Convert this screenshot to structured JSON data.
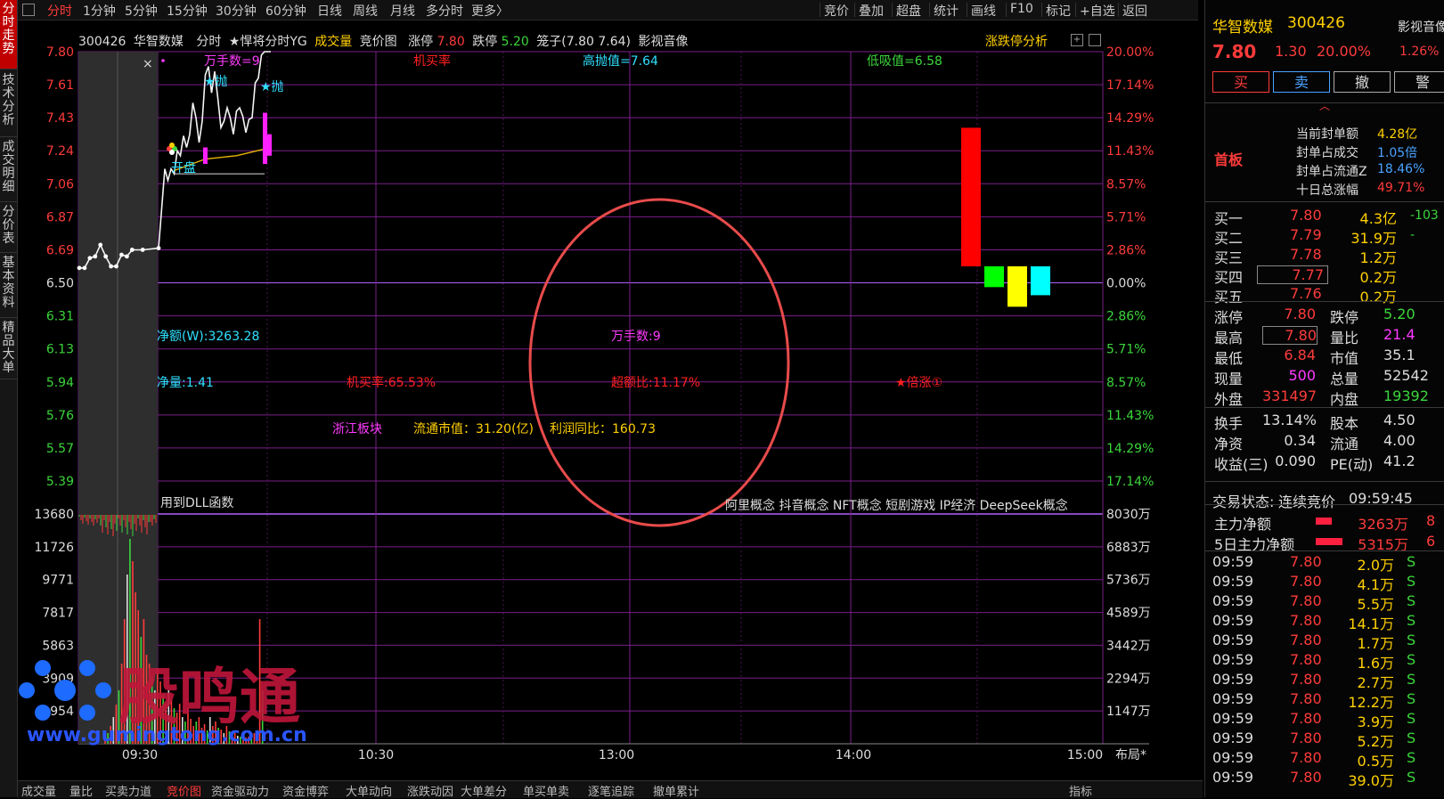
{
  "left_tabs": [
    {
      "label": "分时走势",
      "active": true
    },
    {
      "label": "技术分析",
      "active": false
    },
    {
      "label": "成交明细",
      "active": false
    },
    {
      "label": "分价表",
      "active": false
    },
    {
      "label": "基本资料",
      "active": false
    },
    {
      "label": "精品大单",
      "active": false
    }
  ],
  "periods": [
    {
      "label": "分时",
      "active": true
    },
    {
      "label": "1分钟"
    },
    {
      "label": "5分钟"
    },
    {
      "label": "15分钟"
    },
    {
      "label": "30分钟"
    },
    {
      "label": "60分钟"
    },
    {
      "label": "日线"
    },
    {
      "label": "周线"
    },
    {
      "label": "月线"
    },
    {
      "label": "多分时"
    },
    {
      "label": "更多〉"
    }
  ],
  "tools": [
    "竞价",
    "叠加",
    "超盘",
    "统计",
    "画线",
    "F10",
    "标记",
    "+自选",
    "返回"
  ],
  "info": {
    "code": "300426",
    "name": "华智数媒",
    "mode": "分时",
    "indicator": "★悍将分时YG",
    "volume": "成交量",
    "bid": "竞价图",
    "limit_up_label": "涨停",
    "limit_up": "7.80",
    "limit_down_label": "跌停",
    "limit_down": "5.20",
    "ladder": "笼子(7.80 7.64)",
    "concept": "影视音像",
    "analysis": "涨跌停分析"
  },
  "chart_data": {
    "type": "line",
    "price_ticks": [
      "7.80",
      "7.61",
      "7.43",
      "7.24",
      "7.06",
      "6.87",
      "6.69",
      "6.50",
      "6.31",
      "6.13",
      "5.94",
      "5.76",
      "5.57",
      "5.39"
    ],
    "pct_ticks": [
      "20.00%",
      "17.14%",
      "14.29%",
      "11.43%",
      "8.57%",
      "5.71%",
      "2.86%",
      "0.00%",
      "2.86%",
      "5.71%",
      "8.57%",
      "11.43%",
      "14.29%",
      "17.14%"
    ],
    "vol_ticks": [
      "13680",
      "11726",
      "9771",
      "7817",
      "5863",
      "3909",
      "1954"
    ],
    "amt_ticks": [
      "8030万",
      "6883万",
      "5736万",
      "4589万",
      "3442万",
      "2294万",
      "1147万"
    ],
    "time_ticks": [
      "09:30",
      "10:30",
      "13:00",
      "14:00",
      "15:00"
    ],
    "prev_close": 6.5,
    "price_series": [
      {
        "t": 0,
        "p": 6.49
      },
      {
        "t": 2,
        "p": 6.49
      },
      {
        "t": 4,
        "p": 6.55
      },
      {
        "t": 6,
        "p": 6.56
      },
      {
        "t": 8,
        "p": 6.63
      },
      {
        "t": 10,
        "p": 6.56
      },
      {
        "t": 12,
        "p": 6.5
      },
      {
        "t": 14,
        "p": 6.5
      },
      {
        "t": 16,
        "p": 6.57
      },
      {
        "t": 18,
        "p": 6.56
      },
      {
        "t": 20,
        "p": 6.6
      },
      {
        "t": 24,
        "p": 6.6
      },
      {
        "t": 30,
        "p": 6.61
      },
      {
        "t": 31,
        "p": 6.85
      },
      {
        "t": 32,
        "p": 7.09
      },
      {
        "t": 33,
        "p": 7.02
      },
      {
        "t": 34,
        "p": 7.09
      },
      {
        "t": 35,
        "p": 7.06
      },
      {
        "t": 36,
        "p": 7.2
      },
      {
        "t": 37,
        "p": 7.17
      },
      {
        "t": 38,
        "p": 7.29
      },
      {
        "t": 39,
        "p": 7.22
      },
      {
        "t": 40,
        "p": 7.3
      },
      {
        "t": 41,
        "p": 7.49
      },
      {
        "t": 42,
        "p": 7.4
      },
      {
        "t": 43,
        "p": 7.25
      },
      {
        "t": 44,
        "p": 7.38
      },
      {
        "t": 45,
        "p": 7.66
      },
      {
        "t": 46,
        "p": 7.71
      },
      {
        "t": 47,
        "p": 7.55
      },
      {
        "t": 48,
        "p": 7.68
      },
      {
        "t": 49,
        "p": 7.52
      },
      {
        "t": 50,
        "p": 7.34
      },
      {
        "t": 51,
        "p": 7.38
      },
      {
        "t": 52,
        "p": 7.46
      },
      {
        "t": 53,
        "p": 7.4
      },
      {
        "t": 54,
        "p": 7.3
      },
      {
        "t": 55,
        "p": 7.44
      },
      {
        "t": 56,
        "p": 7.46
      },
      {
        "t": 57,
        "p": 7.41
      },
      {
        "t": 58,
        "p": 7.31
      },
      {
        "t": 59,
        "p": 7.39
      },
      {
        "t": 60,
        "p": 7.4
      },
      {
        "t": 61,
        "p": 7.61
      },
      {
        "t": 62,
        "p": 7.64
      },
      {
        "t": 63,
        "p": 7.78
      },
      {
        "t": 64,
        "p": 7.8
      },
      {
        "t": 66,
        "p": 7.8
      }
    ],
    "side_bars": [
      {
        "color": "#ff0000",
        "value_pct": 12.0
      },
      {
        "color": "#00ff00",
        "value_pct": -1.8
      },
      {
        "color": "#ffff00",
        "value_pct": -3.5
      },
      {
        "color": "#00ffff",
        "value_pct": -2.5
      }
    ]
  },
  "annotations": {
    "wanshou_top": "万手数=9",
    "jimailv": "机买率",
    "gaopao": "高抛值=7.64",
    "dixi": "低吸值=6.58",
    "pao1": "★抛",
    "pao2": "★抛",
    "kaipan": "开盘",
    "jinge": "净额(W):3263.28",
    "wanshou_mid": "万手数:9",
    "jingliang": "净量:1.41",
    "jimailv_val": "机买率:65.53%",
    "chaoebi": "超额比:11.17%",
    "beizhang": "★倍涨①",
    "bankuai": "浙江板块",
    "liutong": "流通市值：31.20(亿)",
    "lirun": "利润同比：160.73",
    "dll": "用到DLL函数",
    "concepts": "阿里概念 抖音概念 NFT概念 短剧游戏 IP经济 DeepSeek概念"
  },
  "watermark": {
    "brand": "股鸣通",
    "url": "www.gumingtong.com.cn"
  },
  "right_panel": {
    "name": "华智数媒",
    "code": "300426",
    "price": "7.80",
    "change": "1.30",
    "pct": "20.00%",
    "side_title": "影视音像",
    "side_pct": "1.26%",
    "buttons": [
      "买",
      "卖",
      "撤",
      "警"
    ],
    "first_board": "首板",
    "seal": [
      {
        "label": "当前封单额",
        "value": "4.28亿"
      },
      {
        "label": "封单占成交",
        "value": "1.05倍"
      },
      {
        "label": "封单占流通Z",
        "value": "18.46%"
      },
      {
        "label": "十日总涨幅",
        "value": "49.71%"
      }
    ],
    "bids": [
      {
        "label": "买一",
        "price": "7.80",
        "vol": "4.3亿",
        "extra": "-103"
      },
      {
        "label": "买二",
        "price": "7.79",
        "vol": "31.9万",
        "extra": "-"
      },
      {
        "label": "买三",
        "price": "7.78",
        "vol": "1.2万",
        "extra": ""
      },
      {
        "label": "买四",
        "price": "7.77",
        "vol": "0.2万",
        "extra": ""
      },
      {
        "label": "买五",
        "price": "7.76",
        "vol": "0.2万",
        "extra": ""
      }
    ],
    "stats": [
      {
        "l1": "涨停",
        "v1": "7.80",
        "l2": "跌停",
        "v2": "5.20"
      },
      {
        "l1": "最高",
        "v1": "7.80",
        "l2": "量比",
        "v2": "21.4"
      },
      {
        "l1": "最低",
        "v1": "6.84",
        "l2": "市值",
        "v2": "35.1"
      },
      {
        "l1": "现量",
        "v1": "500",
        "l2": "总量",
        "v2": "52542"
      },
      {
        "l1": "外盘",
        "v1": "331497",
        "l2": "内盘",
        "v2": "19392"
      }
    ],
    "stats2": [
      {
        "l1": "换手",
        "v1": "13.14%",
        "l2": "股本",
        "v2": "4.50"
      },
      {
        "l1": "净资",
        "v1": "0.34",
        "l2": "流通",
        "v2": "4.00"
      },
      {
        "l1": "收益(三)",
        "v1": "0.090",
        "l2": "PE(动)",
        "v2": "41.2"
      }
    ],
    "status_label": "交易状态:",
    "status": "连续竞价",
    "status_time": "09:59:45",
    "flows": [
      {
        "label": "主力净额",
        "value": "3263万",
        "pct": "8"
      },
      {
        "label": "5日主力净额",
        "value": "5315万",
        "pct": "6"
      }
    ],
    "ticks": [
      {
        "t": "09:59",
        "p": "7.80",
        "v": "2.0万",
        "s": "S"
      },
      {
        "t": "09:59",
        "p": "7.80",
        "v": "4.1万",
        "s": "S"
      },
      {
        "t": "09:59",
        "p": "7.80",
        "v": "5.5万",
        "s": "S"
      },
      {
        "t": "09:59",
        "p": "7.80",
        "v": "14.1万",
        "s": "S"
      },
      {
        "t": "09:59",
        "p": "7.80",
        "v": "1.7万",
        "s": "S"
      },
      {
        "t": "09:59",
        "p": "7.80",
        "v": "1.6万",
        "s": "S"
      },
      {
        "t": "09:59",
        "p": "7.80",
        "v": "2.7万",
        "s": "S"
      },
      {
        "t": "09:59",
        "p": "7.80",
        "v": "12.2万",
        "s": "S"
      },
      {
        "t": "09:59",
        "p": "7.80",
        "v": "3.9万",
        "s": "S"
      },
      {
        "t": "09:59",
        "p": "7.80",
        "v": "5.2万",
        "s": "S"
      },
      {
        "t": "09:59",
        "p": "7.80",
        "v": "0.5万",
        "s": "S"
      },
      {
        "t": "09:59",
        "p": "7.80",
        "v": "39.0万",
        "s": "S"
      }
    ]
  },
  "bottom_tabs": [
    {
      "label": "成交量"
    },
    {
      "label": "量比"
    },
    {
      "label": "买卖力道"
    },
    {
      "label": "竞价图",
      "active": true
    },
    {
      "label": "资金驱动力"
    },
    {
      "label": "资金博弈"
    },
    {
      "label": "大单动向"
    },
    {
      "label": "涨跌动因"
    },
    {
      "label": "大单差分"
    },
    {
      "label": "单买单卖"
    },
    {
      "label": "逐笔追踪"
    },
    {
      "label": "撤单累计"
    }
  ],
  "bottom_right": [
    "布局*",
    "指标"
  ]
}
